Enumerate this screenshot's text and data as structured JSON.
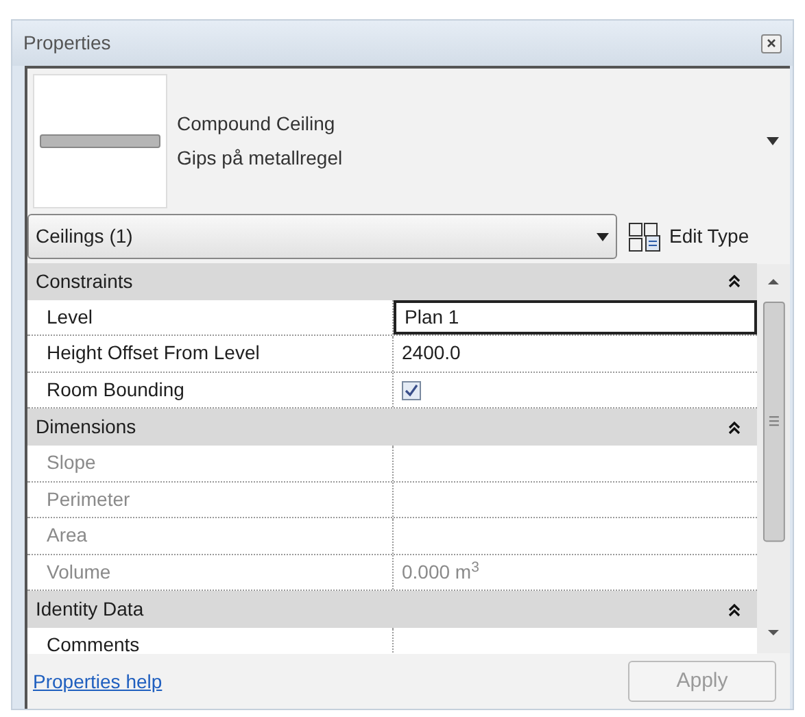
{
  "window": {
    "title": "Properties"
  },
  "type_selector": {
    "family": "Compound Ceiling",
    "type": "Gips på metallregel"
  },
  "filter": {
    "value": "Ceilings (1)"
  },
  "edit_type": {
    "label": "Edit Type"
  },
  "sections": [
    {
      "title": "Constraints",
      "expanded": true,
      "rows": [
        {
          "label": "Level",
          "kind": "text",
          "value": "Plan 1",
          "selected": true,
          "disabled": false
        },
        {
          "label": "Height Offset From Level",
          "kind": "text",
          "value": "2400.0",
          "selected": false,
          "disabled": false
        },
        {
          "label": "Room Bounding",
          "kind": "checkbox",
          "checked": true,
          "selected": false,
          "disabled": false
        }
      ]
    },
    {
      "title": "Dimensions",
      "expanded": true,
      "rows": [
        {
          "label": "Slope",
          "kind": "text",
          "selected": false,
          "disabled": true
        },
        {
          "label": "Perimeter",
          "kind": "text",
          "selected": false,
          "disabled": true
        },
        {
          "label": "Area",
          "kind": "text",
          "selected": false,
          "disabled": true
        },
        {
          "label": "Volume",
          "kind": "text",
          "value": "0.000 m$^{3}$",
          "selected": false,
          "disabled": true
        }
      ]
    },
    {
      "title": "Identity Data",
      "expanded": true,
      "rows": [
        {
          "label": "Comments",
          "kind": "text",
          "selected": false,
          "disabled": false
        }
      ]
    }
  ],
  "footer": {
    "help_link": "Properties help",
    "apply": {
      "label": "Apply",
      "disabled": true
    }
  }
}
